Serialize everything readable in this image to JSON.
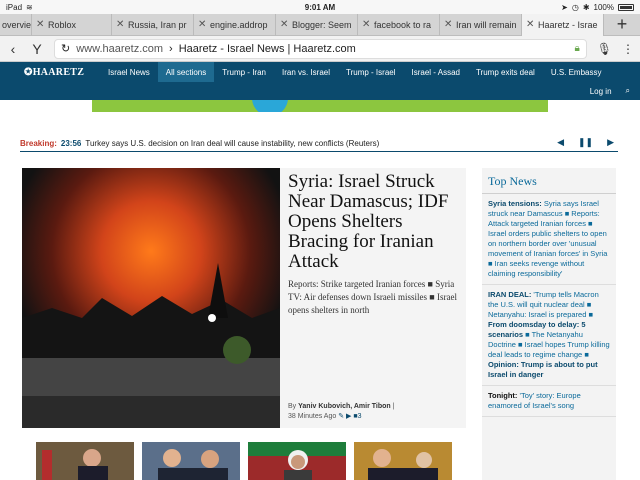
{
  "status": {
    "device": "iPad",
    "time": "9:01 AM",
    "battery": "100%"
  },
  "tabs": [
    {
      "label": "overvie"
    },
    {
      "label": "Roblox"
    },
    {
      "label": "Russia, Iran pr"
    },
    {
      "label": "engine.addrop"
    },
    {
      "label": "Blogger: Seem"
    },
    {
      "label": "facebook to ra"
    },
    {
      "label": "Iran will remain"
    },
    {
      "label": "Haaretz - Israe"
    }
  ],
  "url": {
    "host": "www.haaretz.com",
    "title": "Haaretz - Israel News | Haaretz.com"
  },
  "sitenav": {
    "logo": "HAARETZ",
    "items": [
      "Israel News",
      "All sections",
      "Trump - Iran",
      "Iran vs. Israel",
      "Trump - Israel",
      "Israel - Assad",
      "Trump exits deal",
      "U.S. Embassy"
    ],
    "login": "Log in"
  },
  "breaking": {
    "label": "Breaking:",
    "time": "23:56",
    "text": "Turkey says U.S. decision on Iran deal will cause instability, new conflicts (Reuters)"
  },
  "lead": {
    "headline": "Syria: Israel Struck Near Damascus; IDF Opens Shelters Bracing for Iranian Attack",
    "summary": "Reports: Strike targeted Iranian forces ■ Syria TV: Air defenses down Israeli missiles ■ Israel opens shelters in north",
    "by_prefix": "By",
    "authors": "Yaniv Kubovich, Amir Tibon",
    "sep": "|",
    "ago": "38 Minutes Ago",
    "comments": "3"
  },
  "topnews": {
    "title": "Top News",
    "items": [
      {
        "tag": "Syria tensions:",
        "text": " Syria says Israel struck near Damascus ■ Reports: Attack targeted Iranian forces ■ Israel orders public shelters to open on northern border over 'unusual movement of Iranian forces' in Syria ■ Iran seeks revenge without claiming responsibility'"
      },
      {
        "tag": "IRAN DEAL:",
        "text": " 'Trump tells Macron the U.S. will quit nuclear deal ■ Netanyahu: Israel is prepared ■ ",
        "bold": "From doomsday to delay: 5 scenarios",
        "text2": " ■ The Netanyahu Doctrine ■ Israel hopes Trump killing deal leads to regime change ■ ",
        "bold2": "Opinion: Trump is about to put Israel in danger"
      },
      {
        "tag": "Tonight:",
        "text": " 'Toy' story: Europe enamored of Israel's song"
      }
    ]
  },
  "colors": {
    "brand": "#0b4a6d",
    "link": "#0b6a9a",
    "breaking": "#c0392b"
  }
}
